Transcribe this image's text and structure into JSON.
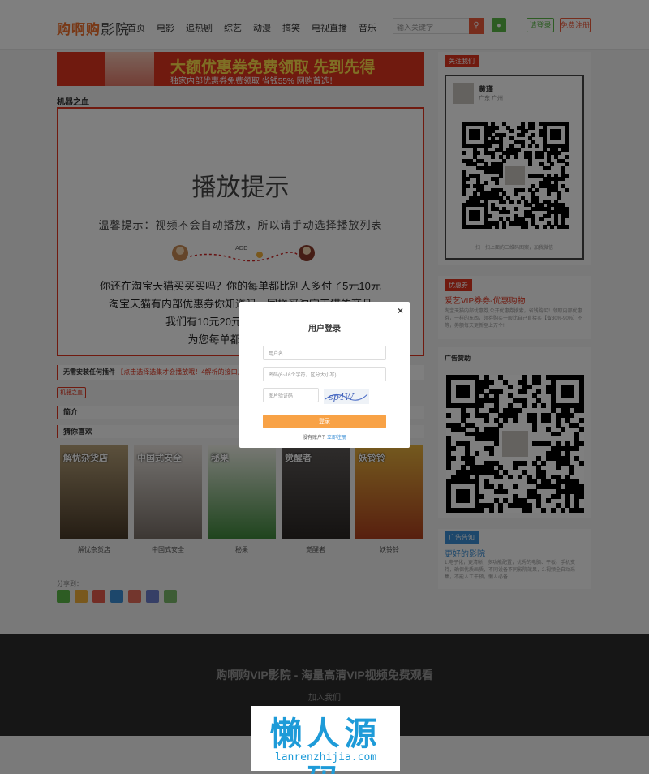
{
  "header": {
    "logo_brand": "购啊购",
    "logo_suffix": "影院",
    "nav": [
      "首页",
      "电影",
      "追热剧",
      "综艺",
      "动漫",
      "搞笑",
      "电视直播",
      "音乐"
    ],
    "search_placeholder": "输入关键字",
    "login_label": "请登录",
    "register_label": "免费注册"
  },
  "banner": {
    "main": "大额优惠券免费领取 先到先得",
    "sub": "独家内部优惠券免费领取 省钱55% 网购首选！"
  },
  "video_title": "机器之血",
  "player": {
    "heading": "播放提示",
    "tip": "温馨提示：视频不会自动播放，所以请手动选择播放列表",
    "deco": "ADD",
    "lines": [
      "你还在淘宝天猫买买买吗？你的每单都比别人多付了5元10元",
      "淘宝天猫有内部优惠券你知道吗，同样买淘宝天猫的商品",
      "我们有10元20元的内部优惠券，",
      "为您每单都省钱！点击"
    ]
  },
  "plugin": {
    "label": "无需安装任何插件",
    "text": "【点击选择选集才会播放哦！4解析的接口是测试"
  },
  "tag": "机器之血",
  "sections": {
    "intro": "简介",
    "guess": "猜你喜欢"
  },
  "posters": [
    {
      "title": "解忧杂货店",
      "poster_text": "解忧杂货店",
      "color_top": "#b8a27a",
      "color_bottom": "#4a3a28"
    },
    {
      "title": "中国式安全",
      "poster_text": "中国式安全",
      "color_top": "#e8e3de",
      "color_bottom": "#7a7068"
    },
    {
      "title": "秘果",
      "poster_text": "秘果",
      "color_top": "#f2f2ea",
      "color_bottom": "#3f8a3c"
    },
    {
      "title": "觉醒者",
      "poster_text": "觉醒者",
      "color_top": "#5e5a58",
      "color_bottom": "#2a2624"
    },
    {
      "title": "妖铃铃",
      "poster_text": "妖铃铃",
      "color_top": "#e8b43e",
      "color_bottom": "#b0401e"
    }
  ],
  "share_label": "分享到：",
  "share_colors": [
    "#5ab946",
    "#f2b03b",
    "#e75b4a",
    "#3b8fd6",
    "#e76d5a",
    "#6d7fcc",
    "#7ab86a"
  ],
  "sidebar": {
    "follow_label": "关注我们",
    "profile_name": "黄瑾",
    "profile_location": "广东 广州",
    "qr_caption": "扫一扫上面的二维码图案，加我微信",
    "coupon_label": "优惠券",
    "coupon_title": "爱艺VIP券券-优惠购物",
    "coupon_text": "淘宝天猫内部优惠券,公开优惠券搜索，省钱购买！领取内部优惠券，一样的东西，领券购买一般比自己直接买【省30%-90%】不等，券额每天更新至上万个!",
    "ad_label": "广告赞助",
    "notice_label": "广告告知",
    "notice_title": "更好的影院",
    "notice_text": "1.电子化，更清晰，多功能配置，优秀的电脑、平板、手机支持，确保优质画质，不同设备不同影院效果，2.视频全自动采集，不能人工干预，懒人必备！"
  },
  "footer": {
    "title": "购啊购VIP影院 - 海量高清VIP视频免费观看",
    "join_label": "加入我们"
  },
  "watermark": {
    "main": "懒人源码",
    "sub": "lanrenzhijia.com"
  },
  "modal": {
    "close": "×",
    "title": "用户登录",
    "username_placeholder": "用户名",
    "password_placeholder": "密码(6~16个字符，区分大小写)",
    "captcha_placeholder": "图片验证码",
    "captcha_text": "sp4W",
    "submit": "登录",
    "no_account": "没有账户？",
    "register_link": "立即注册"
  }
}
